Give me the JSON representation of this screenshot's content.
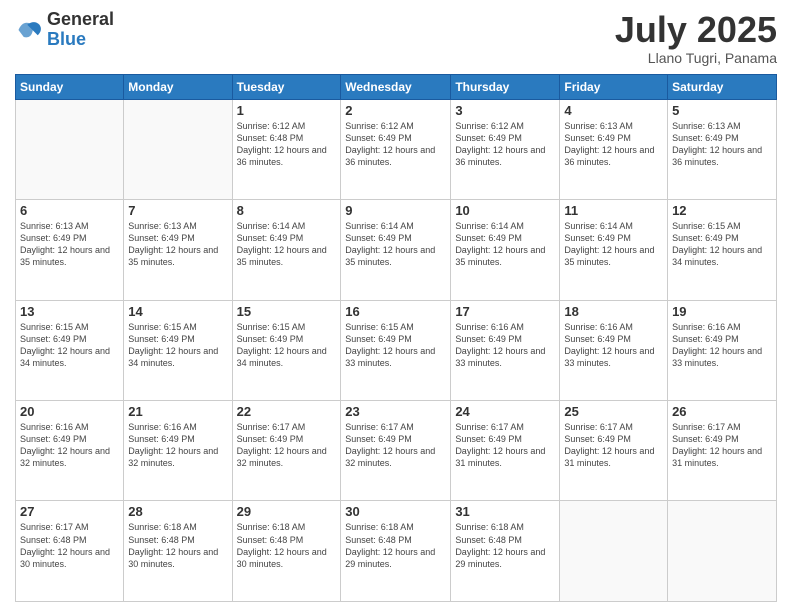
{
  "logo": {
    "general": "General",
    "blue": "Blue"
  },
  "title": "July 2025",
  "location": "Llano Tugri, Panama",
  "days_of_week": [
    "Sunday",
    "Monday",
    "Tuesday",
    "Wednesday",
    "Thursday",
    "Friday",
    "Saturday"
  ],
  "weeks": [
    [
      {
        "day": "",
        "info": ""
      },
      {
        "day": "",
        "info": ""
      },
      {
        "day": "1",
        "info": "Sunrise: 6:12 AM\nSunset: 6:48 PM\nDaylight: 12 hours and 36 minutes."
      },
      {
        "day": "2",
        "info": "Sunrise: 6:12 AM\nSunset: 6:49 PM\nDaylight: 12 hours and 36 minutes."
      },
      {
        "day": "3",
        "info": "Sunrise: 6:12 AM\nSunset: 6:49 PM\nDaylight: 12 hours and 36 minutes."
      },
      {
        "day": "4",
        "info": "Sunrise: 6:13 AM\nSunset: 6:49 PM\nDaylight: 12 hours and 36 minutes."
      },
      {
        "day": "5",
        "info": "Sunrise: 6:13 AM\nSunset: 6:49 PM\nDaylight: 12 hours and 36 minutes."
      }
    ],
    [
      {
        "day": "6",
        "info": "Sunrise: 6:13 AM\nSunset: 6:49 PM\nDaylight: 12 hours and 35 minutes."
      },
      {
        "day": "7",
        "info": "Sunrise: 6:13 AM\nSunset: 6:49 PM\nDaylight: 12 hours and 35 minutes."
      },
      {
        "day": "8",
        "info": "Sunrise: 6:14 AM\nSunset: 6:49 PM\nDaylight: 12 hours and 35 minutes."
      },
      {
        "day": "9",
        "info": "Sunrise: 6:14 AM\nSunset: 6:49 PM\nDaylight: 12 hours and 35 minutes."
      },
      {
        "day": "10",
        "info": "Sunrise: 6:14 AM\nSunset: 6:49 PM\nDaylight: 12 hours and 35 minutes."
      },
      {
        "day": "11",
        "info": "Sunrise: 6:14 AM\nSunset: 6:49 PM\nDaylight: 12 hours and 35 minutes."
      },
      {
        "day": "12",
        "info": "Sunrise: 6:15 AM\nSunset: 6:49 PM\nDaylight: 12 hours and 34 minutes."
      }
    ],
    [
      {
        "day": "13",
        "info": "Sunrise: 6:15 AM\nSunset: 6:49 PM\nDaylight: 12 hours and 34 minutes."
      },
      {
        "day": "14",
        "info": "Sunrise: 6:15 AM\nSunset: 6:49 PM\nDaylight: 12 hours and 34 minutes."
      },
      {
        "day": "15",
        "info": "Sunrise: 6:15 AM\nSunset: 6:49 PM\nDaylight: 12 hours and 34 minutes."
      },
      {
        "day": "16",
        "info": "Sunrise: 6:15 AM\nSunset: 6:49 PM\nDaylight: 12 hours and 33 minutes."
      },
      {
        "day": "17",
        "info": "Sunrise: 6:16 AM\nSunset: 6:49 PM\nDaylight: 12 hours and 33 minutes."
      },
      {
        "day": "18",
        "info": "Sunrise: 6:16 AM\nSunset: 6:49 PM\nDaylight: 12 hours and 33 minutes."
      },
      {
        "day": "19",
        "info": "Sunrise: 6:16 AM\nSunset: 6:49 PM\nDaylight: 12 hours and 33 minutes."
      }
    ],
    [
      {
        "day": "20",
        "info": "Sunrise: 6:16 AM\nSunset: 6:49 PM\nDaylight: 12 hours and 32 minutes."
      },
      {
        "day": "21",
        "info": "Sunrise: 6:16 AM\nSunset: 6:49 PM\nDaylight: 12 hours and 32 minutes."
      },
      {
        "day": "22",
        "info": "Sunrise: 6:17 AM\nSunset: 6:49 PM\nDaylight: 12 hours and 32 minutes."
      },
      {
        "day": "23",
        "info": "Sunrise: 6:17 AM\nSunset: 6:49 PM\nDaylight: 12 hours and 32 minutes."
      },
      {
        "day": "24",
        "info": "Sunrise: 6:17 AM\nSunset: 6:49 PM\nDaylight: 12 hours and 31 minutes."
      },
      {
        "day": "25",
        "info": "Sunrise: 6:17 AM\nSunset: 6:49 PM\nDaylight: 12 hours and 31 minutes."
      },
      {
        "day": "26",
        "info": "Sunrise: 6:17 AM\nSunset: 6:49 PM\nDaylight: 12 hours and 31 minutes."
      }
    ],
    [
      {
        "day": "27",
        "info": "Sunrise: 6:17 AM\nSunset: 6:48 PM\nDaylight: 12 hours and 30 minutes."
      },
      {
        "day": "28",
        "info": "Sunrise: 6:18 AM\nSunset: 6:48 PM\nDaylight: 12 hours and 30 minutes."
      },
      {
        "day": "29",
        "info": "Sunrise: 6:18 AM\nSunset: 6:48 PM\nDaylight: 12 hours and 30 minutes."
      },
      {
        "day": "30",
        "info": "Sunrise: 6:18 AM\nSunset: 6:48 PM\nDaylight: 12 hours and 29 minutes."
      },
      {
        "day": "31",
        "info": "Sunrise: 6:18 AM\nSunset: 6:48 PM\nDaylight: 12 hours and 29 minutes."
      },
      {
        "day": "",
        "info": ""
      },
      {
        "day": "",
        "info": ""
      }
    ]
  ]
}
